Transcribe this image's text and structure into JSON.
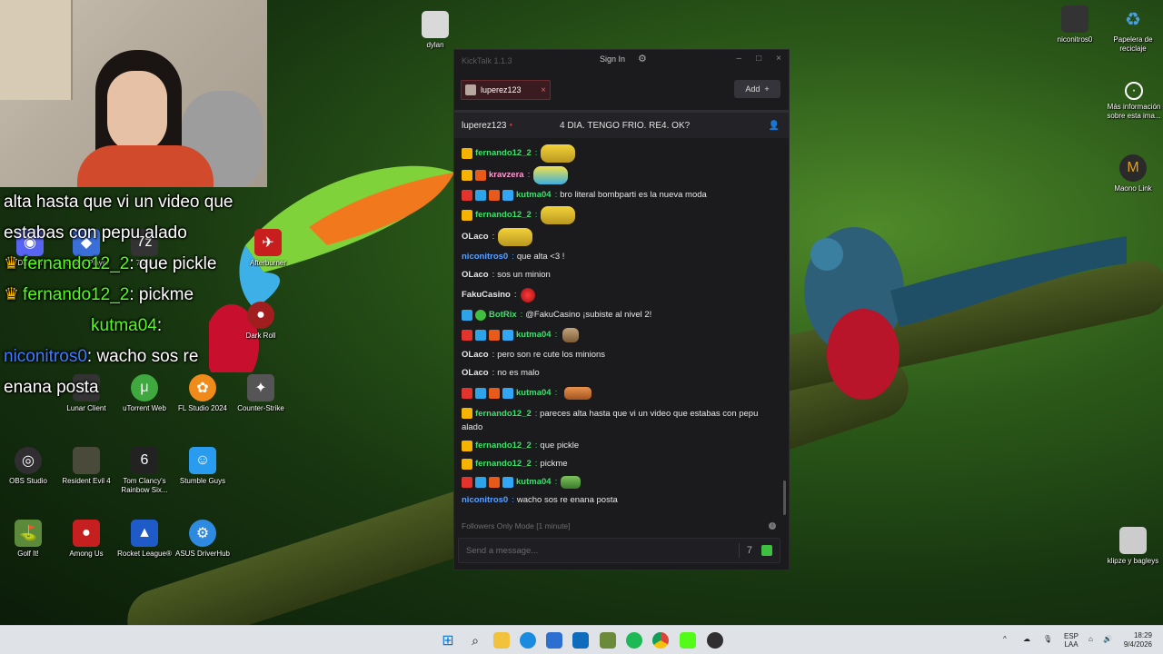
{
  "overlay_chat": [
    {
      "text": "alta hasta que vi un video que"
    },
    {
      "text": "estabas con pepu alado"
    },
    {
      "user": "fernando12_2",
      "text": ": que pickle"
    },
    {
      "user": "fernando12_2",
      "text": ": pickme"
    },
    {
      "user": "kutma04",
      "text": ":"
    },
    {
      "user": "niconitros0",
      "text": ": wacho sos re"
    },
    {
      "text": "enana posta"
    }
  ],
  "desktop_icons": [
    {
      "label": "dylan",
      "color": "#d9d9d9"
    },
    {
      "label": "niconitros0",
      "color": "#333333"
    },
    {
      "label": "Papelera de reciclaje",
      "color": "#4aa0e0"
    },
    {
      "label": "Más información sobre esta ima...",
      "color": "#222222"
    },
    {
      "label": "Maono Link",
      "color": "#e0a020"
    },
    {
      "label": "klipze y bagleys",
      "color": "#cccccc"
    },
    {
      "label": "Discord",
      "color": "#5865f2"
    },
    {
      "label": "Roblox Player",
      "color": "#3a6ed8"
    },
    {
      "label": "7-Zip",
      "color": "#333333"
    },
    {
      "label": "Afterburner",
      "color": "#c81e1e"
    },
    {
      "label": "Dark Roll",
      "color": "#a01e1e"
    },
    {
      "label": "Lunar Client",
      "color": "#333333"
    },
    {
      "label": "uTorrent Web",
      "color": "#3fa83f"
    },
    {
      "label": "FL Studio 2024",
      "color": "#f08a1a"
    },
    {
      "label": "Counter-Strike",
      "color": "#555555"
    },
    {
      "label": "OBS Studio",
      "color": "#302e31"
    },
    {
      "label": "Resident Evil 4",
      "color": "#4a4a3a"
    },
    {
      "label": "Tom Clancy's Rainbow Six...",
      "color": "#222222"
    },
    {
      "label": "Stumble Guys",
      "color": "#2a9cf0"
    },
    {
      "label": "Golf It!",
      "color": "#5a8a3a"
    },
    {
      "label": "Among Us",
      "color": "#c61f1f"
    },
    {
      "label": "Rocket League®",
      "color": "#1e5ac8"
    },
    {
      "label": "ASUS DriverHub",
      "color": "#2e8ae0"
    }
  ],
  "kicktalk": {
    "app_title": "KickTalk 1.1.3",
    "sign_in_label": "Sign In",
    "settings_icon": "gear-icon",
    "minimize": "–",
    "maximize": "□",
    "close": "×",
    "tab": {
      "label": "luperez123",
      "close": "×"
    },
    "add_label": "Add",
    "add_plus": "+",
    "streamer": "luperez123",
    "stream_title": "4 DIA. TENGO FRIO. RE4. OK?",
    "messages": [
      {
        "user": "fernando12_2",
        "sep": ":",
        "text": ""
      },
      {
        "user": "kravzera",
        "sep": ":",
        "text": ""
      },
      {
        "user": "kutma04",
        "sep": ":",
        "text": "bro literal bombparti es la nueva moda"
      },
      {
        "user": "fernando12_2",
        "sep": ":",
        "text": ""
      },
      {
        "user": "OLaco",
        "sep": ":",
        "text": ""
      },
      {
        "user": "niconitros0",
        "sep": ":",
        "text": "que alta <3 !"
      },
      {
        "user": "OLaco",
        "sep": ":",
        "text": "sos un minion"
      },
      {
        "user": "FakuCasino",
        "sep": ":",
        "text": ""
      },
      {
        "user": "BotRix",
        "sep": ":",
        "text": "@FakuCasino ¡subiste al nivel 2!"
      },
      {
        "user": "kutma04",
        "sep": ":",
        "text": ""
      },
      {
        "user": "OLaco",
        "sep": ":",
        "text": "pero son re cute los minions"
      },
      {
        "user": "OLaco",
        "sep": ":",
        "text": "no es malo"
      },
      {
        "user": "kutma04",
        "sep": ":",
        "text": ""
      },
      {
        "user": "fernando12_2",
        "sep": ":",
        "text": "pareces alta hasta que vi un video que estabas con pepu alado"
      },
      {
        "user": "fernando12_2",
        "sep": ":",
        "text": "que pickle"
      },
      {
        "user": "fernando12_2",
        "sep": ":",
        "text": "pickme"
      },
      {
        "user": "kutma04",
        "sep": ":",
        "text": ""
      },
      {
        "user": "niconitros0",
        "sep": ":",
        "text": "wacho sos re enana posta"
      }
    ],
    "mode_text": "Followers Only Mode [1 minute]",
    "input_placeholder": "Send a message..."
  },
  "taskbar": {
    "lang_top": "ESP",
    "lang_bottom": "LAA",
    "time": "18:29",
    "date": "9/4/2026"
  },
  "colors": {
    "kick_green": "#53fc18",
    "chat_bg": "#1b1b1e",
    "tab_active_border": "#6b2a31"
  }
}
